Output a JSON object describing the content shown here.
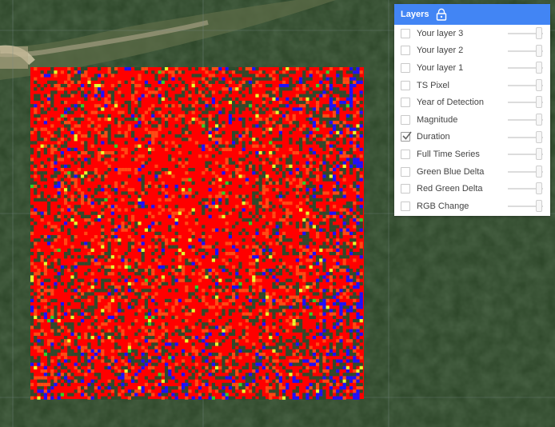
{
  "map": {
    "type": "satellite",
    "overlay_colors": {
      "dominant": "#ff0000",
      "secondary": "#ff4a14",
      "accent_blue": "#1a12ff",
      "accent_yellow": "#e6ff2e",
      "accent_green": "#2fd12a",
      "forest": "#2f4a2c"
    }
  },
  "layers_panel": {
    "title": "Layers",
    "lock_icon": "lock-icon",
    "layers": [
      {
        "label": "Your layer 3",
        "checked": false,
        "opacity": 1.0
      },
      {
        "label": "Your layer 2",
        "checked": false,
        "opacity": 1.0
      },
      {
        "label": "Your layer 1",
        "checked": false,
        "opacity": 1.0
      },
      {
        "label": "TS Pixel",
        "checked": false,
        "opacity": 1.0
      },
      {
        "label": "Year of Detection",
        "checked": false,
        "opacity": 1.0
      },
      {
        "label": "Magnitude",
        "checked": false,
        "opacity": 1.0
      },
      {
        "label": "Duration",
        "checked": true,
        "opacity": 1.0
      },
      {
        "label": "Full Time Series",
        "checked": false,
        "opacity": 1.0
      },
      {
        "label": "Green Blue Delta",
        "checked": false,
        "opacity": 1.0
      },
      {
        "label": "Red Green Delta",
        "checked": false,
        "opacity": 1.0
      },
      {
        "label": "RGB Change",
        "checked": false,
        "opacity": 1.0
      }
    ]
  }
}
